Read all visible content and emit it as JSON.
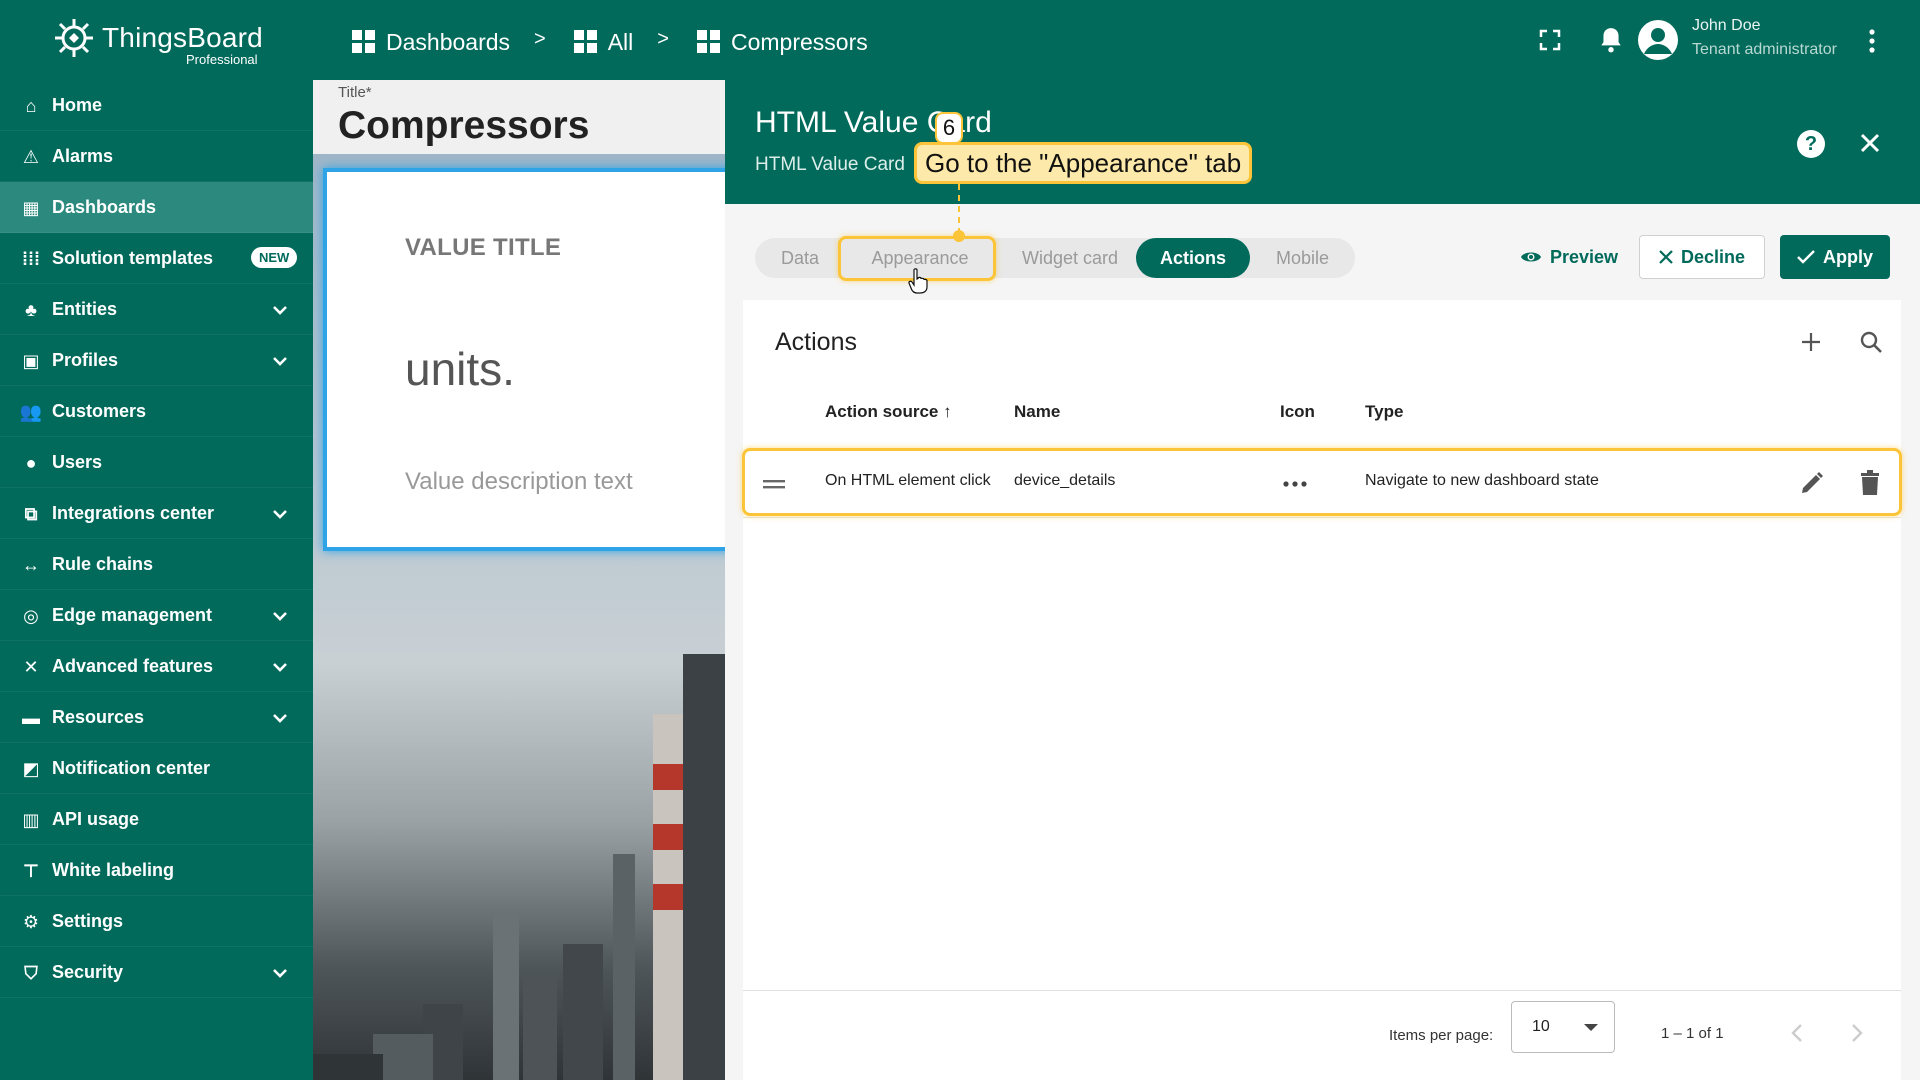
{
  "app": {
    "brand": "ThingsBoard",
    "brand_sub": "Professional",
    "colors": {
      "primary": "#016a5b",
      "accent_highlight": "#fcc438",
      "selection": "#2ea4e6"
    }
  },
  "breadcrumb": [
    {
      "label": "Dashboards",
      "icon": "dashboard-grid-icon"
    },
    {
      "label": "All",
      "icon": "dashboard-grid-icon"
    },
    {
      "label": "Compressors",
      "icon": "dashboard-grid-icon"
    }
  ],
  "breadcrumb_separator": ">",
  "user": {
    "name": "John Doe",
    "role": "Tenant administrator"
  },
  "sidebar": {
    "items": [
      {
        "label": "Home",
        "icon": "home-icon"
      },
      {
        "label": "Alarms",
        "icon": "alarm-warning-icon"
      },
      {
        "label": "Dashboards",
        "icon": "dashboard-grid-icon",
        "active": true
      },
      {
        "label": "Solution templates",
        "icon": "apps-grid-icon",
        "badge": "NEW"
      },
      {
        "label": "Entities",
        "icon": "entities-icon",
        "expandable": true
      },
      {
        "label": "Profiles",
        "icon": "profiles-icon",
        "expandable": true
      },
      {
        "label": "Customers",
        "icon": "customers-icon"
      },
      {
        "label": "Users",
        "icon": "user-circle-icon"
      },
      {
        "label": "Integrations center",
        "icon": "integrations-icon",
        "expandable": true
      },
      {
        "label": "Rule chains",
        "icon": "rule-chains-icon"
      },
      {
        "label": "Edge management",
        "icon": "edge-icon",
        "expandable": true
      },
      {
        "label": "Advanced features",
        "icon": "tools-icon",
        "expandable": true
      },
      {
        "label": "Resources",
        "icon": "folder-icon",
        "expandable": true
      },
      {
        "label": "Notification center",
        "icon": "notification-icon"
      },
      {
        "label": "API usage",
        "icon": "chart-icon"
      },
      {
        "label": "White labeling",
        "icon": "paint-roller-icon"
      },
      {
        "label": "Settings",
        "icon": "gear-icon"
      },
      {
        "label": "Security",
        "icon": "shield-icon",
        "expandable": true
      }
    ]
  },
  "dashboard": {
    "title_label": "Title*",
    "title": "Compressors",
    "value_card": {
      "title": "VALUE TITLE",
      "units": "units.",
      "description": "Value description text"
    }
  },
  "widget_panel": {
    "title": "HTML Value Card",
    "subtitle": "HTML Value Card",
    "tabs": [
      {
        "label": "Data"
      },
      {
        "label": "Appearance"
      },
      {
        "label": "Widget card"
      },
      {
        "label": "Actions",
        "active": true
      },
      {
        "label": "Mobile"
      }
    ],
    "preview_label": "Preview",
    "decline_label": "Decline",
    "apply_label": "Apply",
    "help_label": "?",
    "actions": {
      "title": "Actions",
      "columns": {
        "source": "Action source",
        "name": "Name",
        "icon": "Icon",
        "type": "Type"
      },
      "rows": [
        {
          "source": "On HTML element click",
          "name": "device_details",
          "icon": "more-horiz-icon",
          "type": "Navigate to new dashboard state"
        }
      ],
      "items_per_page_label": "Items per page:",
      "items_per_page": "10",
      "range": "1 – 1 of 1"
    }
  },
  "tutorial": {
    "step": "6",
    "tip": "Go to the \"Appearance\" tab"
  }
}
